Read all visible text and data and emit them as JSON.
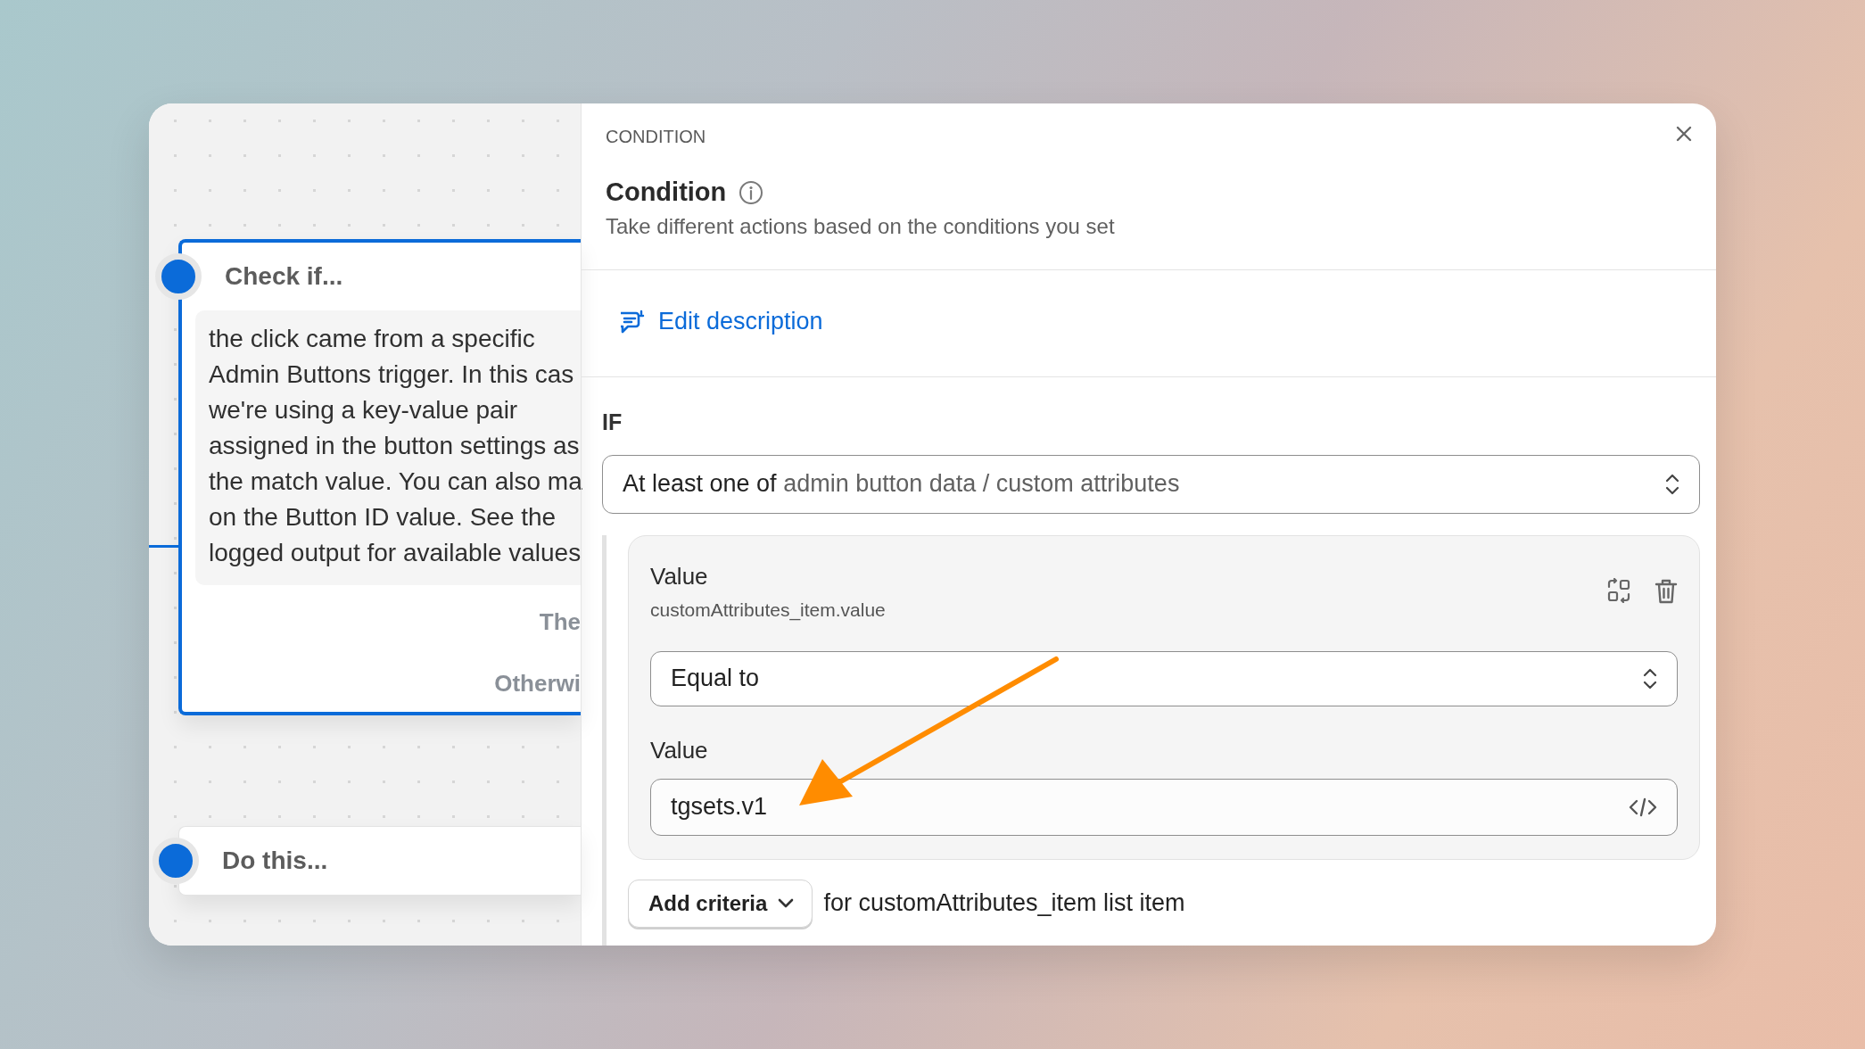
{
  "canvas": {
    "check_card": {
      "title": "Check if...",
      "description_lines": [
        "the click came from a specific",
        "Admin Buttons trigger. In this cas",
        "we're using a key-value pair",
        "assigned in the button settings as",
        "the match value. You can also ma",
        "on the Button ID value. See the",
        "logged output for available values"
      ],
      "then_label": "The",
      "otherwise_label": "Otherwi"
    },
    "do_card": {
      "title": "Do this..."
    }
  },
  "panel": {
    "eyebrow": "CONDITION",
    "title": "Condition",
    "subtitle": "Take different actions based on the conditions you set",
    "edit_link": "Edit description",
    "if_label": "IF",
    "scope_select": {
      "prefix": "At least one of",
      "value": "admin button data / custom attributes"
    },
    "criterion": {
      "label": "Value",
      "path": "customAttributes_item.value",
      "operator": "Equal to",
      "value_label": "Value",
      "value": "tgsets.v1"
    },
    "add_button": "Add criteria",
    "add_suffix": "for customAttributes_item list item"
  }
}
